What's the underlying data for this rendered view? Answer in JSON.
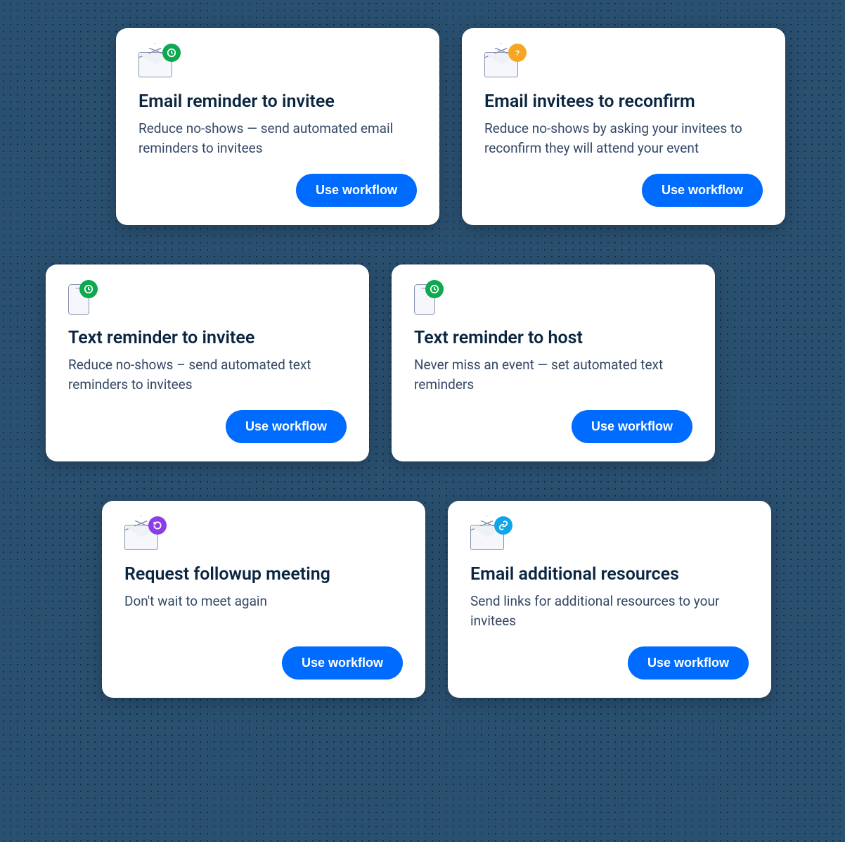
{
  "button_label": "Use workflow",
  "cards": [
    {
      "icon": "envelope",
      "badge_color": "green",
      "badge_icon": "clock",
      "title": "Email reminder to invitee",
      "desc": "Reduce no-shows — send automated email reminders to invitees"
    },
    {
      "icon": "envelope",
      "badge_color": "orange",
      "badge_icon": "question",
      "title": "Email invitees to reconfirm",
      "desc": "Reduce no-shows by asking your invitees to reconfirm they will attend your event"
    },
    {
      "icon": "phone",
      "badge_color": "green",
      "badge_icon": "clock",
      "title": "Text reminder to invitee",
      "desc": "Reduce no-shows – send automated text reminders to invitees"
    },
    {
      "icon": "phone",
      "badge_color": "green",
      "badge_icon": "clock",
      "title": "Text reminder to host",
      "desc": "Never miss an event — set automated text reminders"
    },
    {
      "icon": "envelope",
      "badge_color": "purple",
      "badge_icon": "refresh",
      "title": "Request followup meeting",
      "desc": "Don't wait to meet again"
    },
    {
      "icon": "envelope",
      "badge_color": "blue",
      "badge_icon": "link",
      "title": "Email additional resources",
      "desc": "Send links for additional resources to your invitees"
    }
  ]
}
